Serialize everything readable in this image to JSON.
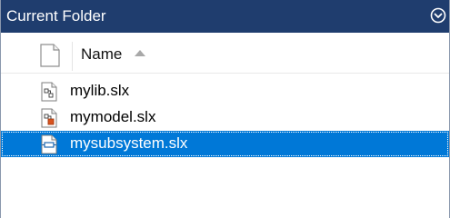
{
  "panel": {
    "title": "Current Folder",
    "menu_icon": "chevron-circle-down-icon"
  },
  "table": {
    "columns": {
      "type_icon": "blank-file-icon",
      "name_label": "Name",
      "sort": "ascending"
    },
    "rows": [
      {
        "name": "mylib.slx",
        "icon": "simulink-library-icon",
        "selected": false
      },
      {
        "name": "mymodel.slx",
        "icon": "simulink-model-icon",
        "selected": false
      },
      {
        "name": "mysubsystem.slx",
        "icon": "simulink-subsystem-icon",
        "selected": true
      }
    ]
  },
  "colors": {
    "title_bar": "#1f3d6e",
    "selection": "#0078d7",
    "model_accent": "#d9531e"
  }
}
